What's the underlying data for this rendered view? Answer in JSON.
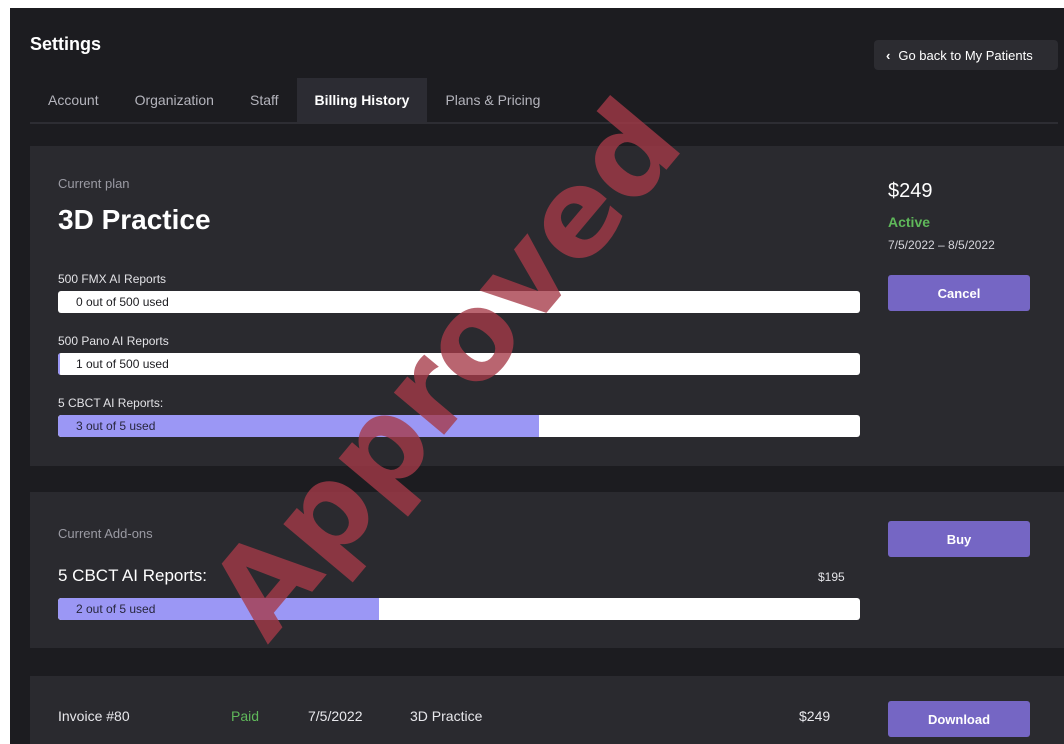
{
  "header": {
    "title": "Settings",
    "back_label": "Go back to My Patients"
  },
  "tabs": [
    {
      "label": "Account",
      "active": false
    },
    {
      "label": "Organization",
      "active": false
    },
    {
      "label": "Staff",
      "active": false
    },
    {
      "label": "Billing History",
      "active": true
    },
    {
      "label": "Plans & Pricing",
      "active": false
    }
  ],
  "plan": {
    "section_label": "Current plan",
    "name": "3D Practice",
    "price": "$249",
    "status": "Active",
    "period": "7/5/2022 – 8/5/2022",
    "cancel_label": "Cancel",
    "quotas": [
      {
        "label": "500 FMX AI Reports",
        "usage_text": "0 out of 500 used",
        "used": 0,
        "total": 500
      },
      {
        "label": "500 Pano AI Reports",
        "usage_text": "1 out of 500 used",
        "used": 1,
        "total": 500
      },
      {
        "label": "5 CBCT AI Reports:",
        "usage_text": "3 out of 5 used",
        "used": 3,
        "total": 5
      }
    ]
  },
  "addons": {
    "section_label": "Current Add-ons",
    "buy_label": "Buy",
    "item": {
      "name": "5 CBCT AI Reports:",
      "price": "$195",
      "usage_text": "2 out of 5 used",
      "used": 2,
      "total": 5
    }
  },
  "invoice": {
    "number": "Invoice #80",
    "status": "Paid",
    "date": "7/5/2022",
    "plan": "3D Practice",
    "amount": "$249",
    "download_label": "Download"
  },
  "watermark": "Approved",
  "colors": {
    "accent": "#7566c4",
    "progress_fill": "#9b97f5",
    "status_green": "#5fb85a",
    "watermark": "#a53a48"
  }
}
